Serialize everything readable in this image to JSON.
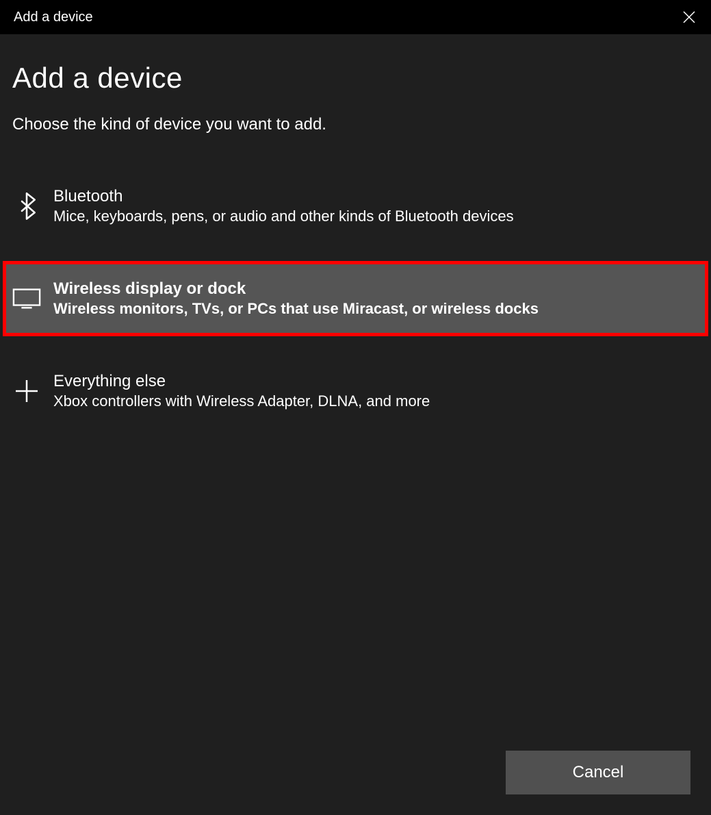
{
  "titlebar": {
    "title": "Add a device"
  },
  "main": {
    "heading": "Add a device",
    "subheading": "Choose the kind of device you want to add."
  },
  "options": [
    {
      "icon": "bluetooth-icon",
      "title": "Bluetooth",
      "desc": "Mice, keyboards, pens, or audio and other kinds of Bluetooth devices",
      "highlighted": false
    },
    {
      "icon": "monitor-icon",
      "title": "Wireless display or dock",
      "desc": "Wireless monitors, TVs, or PCs that use Miracast, or wireless docks",
      "highlighted": true
    },
    {
      "icon": "plus-icon",
      "title": "Everything else",
      "desc": "Xbox controllers with Wireless Adapter, DLNA, and more",
      "highlighted": false
    }
  ],
  "footer": {
    "cancel": "Cancel"
  },
  "colors": {
    "background": "#1f1f1f",
    "titlebar": "#000000",
    "highlight_bg": "#555555",
    "highlight_border": "#ff0000",
    "button_bg": "#505050"
  }
}
